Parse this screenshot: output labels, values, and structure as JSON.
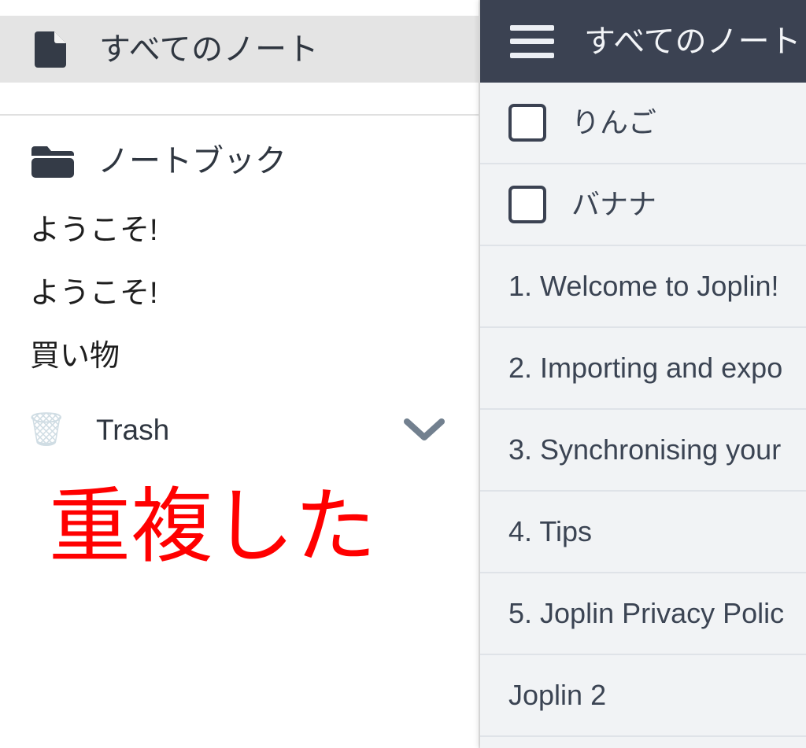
{
  "app": {
    "name": "Joplin"
  },
  "sidebar": {
    "all_notes": {
      "label": "すべてのノート",
      "icon": "document-icon",
      "selected": true
    },
    "notebooks_section": {
      "label": "ノートブック",
      "icon": "folder-icon"
    },
    "notebooks": [
      {
        "label": "ようこそ!"
      },
      {
        "label": "ようこそ!"
      },
      {
        "label": "買い物"
      }
    ],
    "trash": {
      "label": "Trash",
      "icon": "wastebasket-icon",
      "emoji": "🗑",
      "expander_icon": "chevron-down-icon"
    },
    "annotation": {
      "text": "重複した",
      "color": "#ff0000"
    }
  },
  "notes_panel": {
    "header": {
      "menu_icon": "hamburger-menu-icon",
      "title": "すべてのノート"
    },
    "notes": [
      {
        "title": "りんご",
        "is_todo": true,
        "checked": false
      },
      {
        "title": "バナナ",
        "is_todo": true,
        "checked": false
      },
      {
        "title": "1. Welcome to Joplin!",
        "is_todo": false
      },
      {
        "title": "2. Importing and expo",
        "is_todo": false
      },
      {
        "title": "3. Synchronising your",
        "is_todo": false
      },
      {
        "title": "4. Tips",
        "is_todo": false
      },
      {
        "title": "5. Joplin Privacy Polic",
        "is_todo": false
      },
      {
        "title": "Joplin 2",
        "is_todo": false
      }
    ]
  },
  "colors": {
    "header_bar": "#3b4252",
    "selected_row": "#e4e4e4",
    "note_list_bg": "#f1f3f5",
    "divider": "#dfe3e8",
    "text_primary": "#2f3640",
    "annotation_red": "#ff0000"
  }
}
